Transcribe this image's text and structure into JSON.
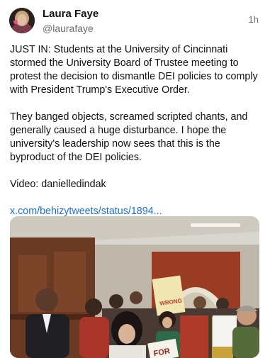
{
  "post": {
    "author": {
      "display_name": "Laura Faye",
      "handle": "@laurafaye"
    },
    "timestamp": "1h",
    "paragraphs": [
      "JUST IN: Students at the University of Cincinnati stormed the University Board of Trustee meeting to protest the decision to dismantle DEI policies to comply with President Trump's Executive Order.",
      "They banged objects, screamed scripted chants, and generally caused a huge disturbance. I hope the university's leadership now sees that this is the byproduct of the DEI policies.",
      "Video: danielledindak"
    ],
    "link_text": "x.com/behizytweets/status/1894...",
    "media": {
      "kind": "video-thumbnail",
      "sign_texts": [
        "WRONG",
        "FOR"
      ]
    }
  },
  "colors": {
    "link": "#1d6fe0",
    "secondary_text": "#6b6b6b",
    "primary_text": "#111111"
  },
  "icons": {
    "avatar": "profile-photo"
  }
}
